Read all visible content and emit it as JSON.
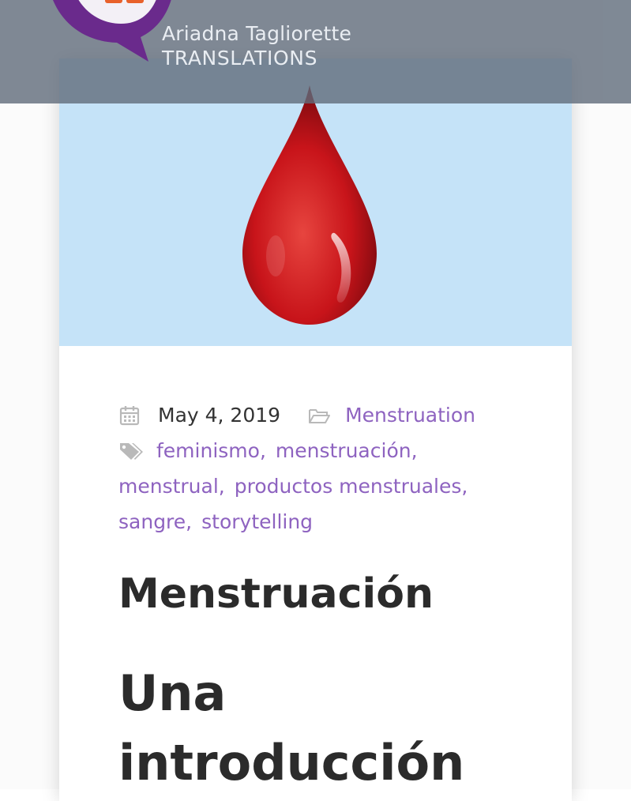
{
  "brand": {
    "name": "Ariadna Tagliorette",
    "subtitle": "TRANSLATIONS"
  },
  "post": {
    "date": "May 4, 2019",
    "category": "Menstruation",
    "tags": [
      "feminismo",
      "menstruación",
      "menstrual",
      "productos menstruales",
      "sangre",
      "storytelling"
    ],
    "title": "Menstruación",
    "heading_line1": "Una",
    "heading_line2": "introducción"
  },
  "icons": {
    "date": "calendar-icon",
    "category": "folder-icon",
    "tags": "tags-icon",
    "hero": "blood-drop-icon"
  },
  "colors": {
    "link": "#8e63c0",
    "hero_bg": "#c5e3f8",
    "header_overlay": "#606c7b",
    "drop": "#c8141a",
    "logo": "#6a2a8c"
  }
}
